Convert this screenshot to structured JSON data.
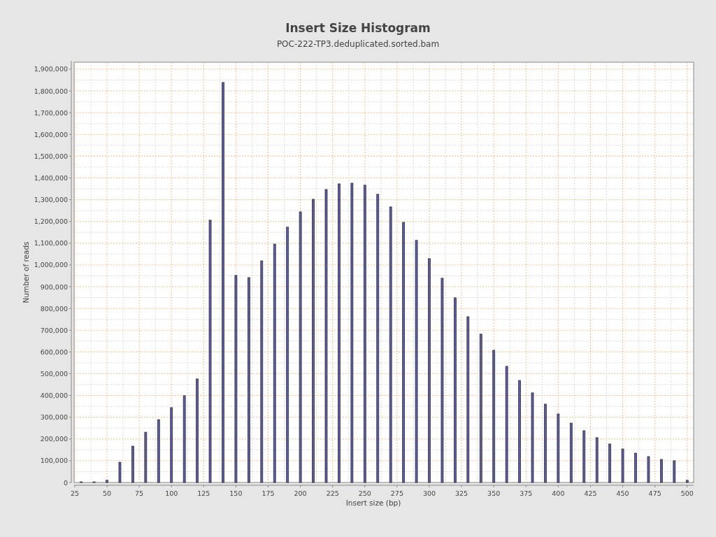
{
  "subtitle": "POC-222-TP3.deduplicated.sorted.bam",
  "chart_data": {
    "type": "bar",
    "title": "Insert Size Histogram",
    "xlabel": "Insert size (bp)",
    "ylabel": "Number of reads",
    "x": [
      30,
      40,
      50,
      60,
      70,
      80,
      90,
      100,
      110,
      120,
      130,
      140,
      150,
      160,
      170,
      180,
      190,
      200,
      210,
      220,
      230,
      240,
      250,
      260,
      270,
      280,
      290,
      300,
      310,
      320,
      330,
      340,
      350,
      360,
      370,
      380,
      390,
      400,
      410,
      420,
      430,
      440,
      450,
      460,
      470,
      480,
      490,
      500
    ],
    "series": [
      {
        "color": "#5b5ba6",
        "values": [
          3000,
          3000,
          10000,
          93000,
          167000,
          231000,
          289000,
          344000,
          399000,
          476000,
          1206000,
          1839000,
          952000,
          942000,
          1019000,
          1096000,
          1174000,
          1244000,
          1302000,
          1347000,
          1373000,
          1376000,
          1367000,
          1325000,
          1267000,
          1196000,
          1113000,
          1029000,
          939000,
          849000,
          762000,
          682000,
          608000,
          534000,
          469000,
          412000,
          360000,
          315000,
          273000,
          238000,
          206000,
          177000,
          154000,
          135000,
          119000,
          106000,
          100000,
          10000
        ]
      }
    ],
    "grid": true,
    "xlim": [
      24.5,
      505
    ],
    "ylim": [
      0,
      1932000
    ],
    "xticks": [
      25,
      50,
      75,
      100,
      125,
      150,
      175,
      200,
      225,
      250,
      275,
      300,
      325,
      350,
      375,
      400,
      425,
      450,
      475,
      500
    ],
    "yticks": [
      {
        "value": 0,
        "label": "0"
      },
      {
        "value": 100000,
        "label": "100,000"
      },
      {
        "value": 200000,
        "label": "200,000"
      },
      {
        "value": 300000,
        "label": "300,000"
      },
      {
        "value": 400000,
        "label": "400,000"
      },
      {
        "value": 500000,
        "label": "500,000"
      },
      {
        "value": 600000,
        "label": "600,000"
      },
      {
        "value": 700000,
        "label": "700,000"
      },
      {
        "value": 800000,
        "label": "800,000"
      },
      {
        "value": 900000,
        "label": "900,000"
      },
      {
        "value": 1000000,
        "label": "1,000,000"
      },
      {
        "value": 1100000,
        "label": "1,100,000"
      },
      {
        "value": 1200000,
        "label": "1,200,000"
      },
      {
        "value": 1300000,
        "label": "1,300,000"
      },
      {
        "value": 1400000,
        "label": "1,400,000"
      },
      {
        "value": 1500000,
        "label": "1,500,000"
      },
      {
        "value": 1600000,
        "label": "1,600,000"
      },
      {
        "value": 1700000,
        "label": "1,700,000"
      },
      {
        "value": 1800000,
        "label": "1,800,000"
      },
      {
        "value": 1900000,
        "label": "1,900,000"
      }
    ]
  }
}
